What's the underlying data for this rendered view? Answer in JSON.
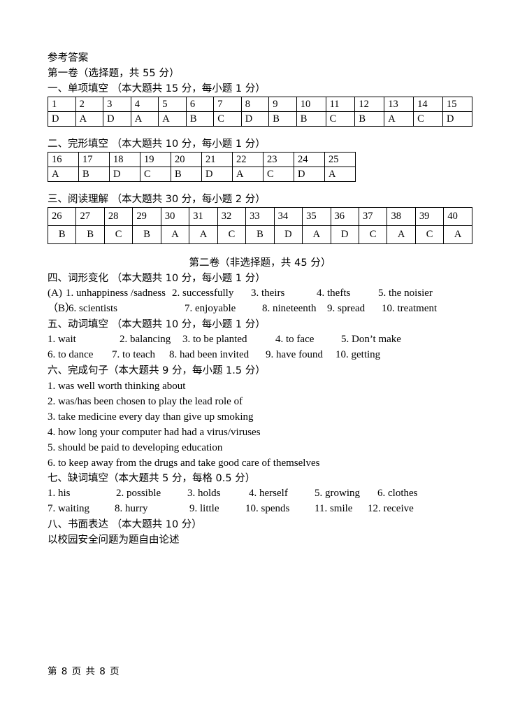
{
  "document": {
    "title": "参考答案",
    "part1_heading": "第一卷（选择题，共 55 分）",
    "part2_heading": "第二卷（非选择题，共 45 分）",
    "footer": "第 8 页 共 8 页"
  },
  "section1": {
    "title": "一、单项填空  （本大题共 15 分，每小题 1 分）",
    "numbers": [
      "1",
      "2",
      "3",
      "4",
      "5",
      "6",
      "7",
      "8",
      "9",
      "10",
      "11",
      "12",
      "13",
      "14",
      "15"
    ],
    "answers": [
      "D",
      "A",
      "D",
      "A",
      "A",
      "B",
      "C",
      "D",
      "B",
      "B",
      "C",
      "B",
      "A",
      "C",
      "D"
    ]
  },
  "section2": {
    "title": "二、完形填空  （本大题共 10 分，每小题 1 分）",
    "numbers": [
      "16",
      "17",
      "18",
      "19",
      "20",
      "21",
      "22",
      "23",
      "24",
      "25"
    ],
    "answers": [
      "A",
      "B",
      "D",
      "C",
      "B",
      "D",
      "A",
      "C",
      "D",
      "A"
    ]
  },
  "section3": {
    "title": "三、阅读理解  （本大题共 30 分，每小题 2 分）",
    "numbers": [
      "26",
      "27",
      "28",
      "29",
      "30",
      "31",
      "32",
      "33",
      "34",
      "35",
      "36",
      "37",
      "38",
      "39",
      "40"
    ],
    "answers": [
      "B",
      "B",
      "C",
      "B",
      "A",
      "A",
      "C",
      "B",
      "D",
      "A",
      "D",
      "C",
      "A",
      "C",
      "A"
    ]
  },
  "section4": {
    "title": "四、词形变化   （本大题共 10 分，每小题 1 分）",
    "row_a": {
      "label": "(A)",
      "items": [
        "1. unhappiness /sadness",
        "2. successfully",
        "3. theirs",
        "4. thefts",
        "5. the noisier"
      ]
    },
    "row_b": {
      "label": "（B）",
      "items": [
        "6. scientists",
        "7. enjoyable",
        "8. nineteenth",
        "9. spread",
        "10. treatment"
      ]
    }
  },
  "section5": {
    "title": "五、动词填空  （本大题共 10 分，每小题 1 分）",
    "row1": [
      "1. wait",
      "2. balancing",
      "3. to be planted",
      "4. to face",
      "5. Don’t make"
    ],
    "row2": [
      "6. to dance",
      "7. to teach",
      "8. had been invited",
      "9. have found",
      "10. getting"
    ]
  },
  "section6": {
    "title": "六、完成句子（本大题共 9 分，每小题 1.5 分）",
    "items": [
      "1. was well worth thinking about",
      "2. was/has been chosen to play the lead role of",
      "3. take medicine every day than give up smoking",
      "4. how long your computer had had a virus/viruses",
      "5. should be paid to developing education",
      "6. to keep away from the drugs and take good care of themselves"
    ]
  },
  "section7": {
    "title": "七、缺词填空（本大题共 5 分，每格 0.5 分）",
    "row1": [
      "1. his",
      "2. possible",
      "3. holds",
      "4. herself",
      "5. growing",
      "6. clothes"
    ],
    "row2": [
      "7. waiting",
      "8. hurry",
      "9. little",
      "10. spends",
      "11. smile",
      "12. receive"
    ]
  },
  "section8": {
    "title": "八、书面表达   （本大题共 10 分）",
    "prompt": "以校园安全问题为题自由论述"
  }
}
